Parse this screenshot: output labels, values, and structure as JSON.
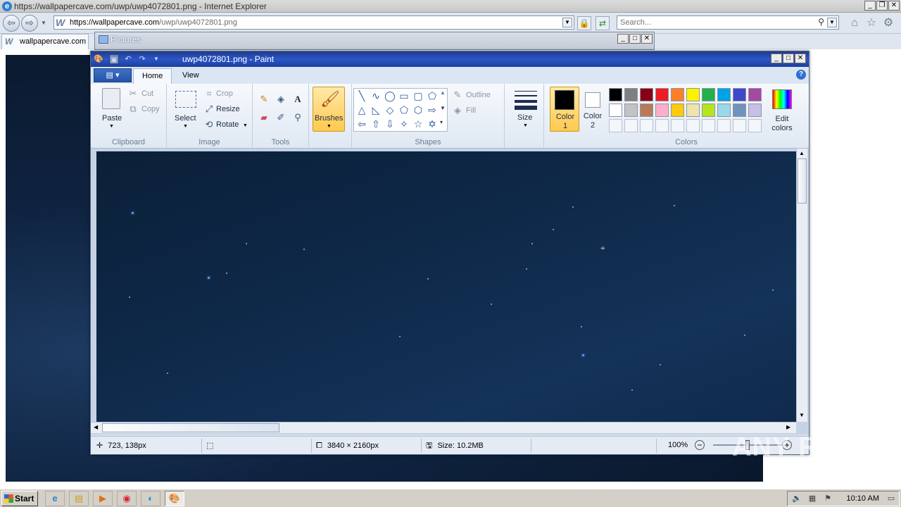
{
  "browser": {
    "title": "https://wallpapercave.com/uwp/uwp4072801.png - Internet Explorer",
    "address": {
      "host": "https://wallpapercave.com",
      "path": "/uwp/uwp4072801.png"
    },
    "search_placeholder": "Search...",
    "tab_label": "wallpapercave.com"
  },
  "pictures_window": {
    "title": "Pictures"
  },
  "paint": {
    "title": "uwp4072801.png - Paint",
    "tabs": [
      "Home",
      "View"
    ],
    "groups": {
      "clipboard": {
        "label": "Clipboard",
        "paste": "Paste",
        "cut": "Cut",
        "copy": "Copy"
      },
      "image": {
        "label": "Image",
        "select": "Select",
        "crop": "Crop",
        "resize": "Resize",
        "rotate": "Rotate"
      },
      "tools": {
        "label": "Tools"
      },
      "brushes": {
        "label": "Brushes"
      },
      "shapes": {
        "label": "Shapes",
        "outline": "Outline",
        "fill": "Fill"
      },
      "size": {
        "label": "Size"
      },
      "colors": {
        "label": "Colors",
        "color1": "Color\n1",
        "color2": "Color\n2",
        "edit": "Edit\ncolors",
        "color1_value": "#000000",
        "color2_value": "#ffffff",
        "palette_row1": [
          "#000000",
          "#7f7f7f",
          "#880015",
          "#ed1c24",
          "#ff7f27",
          "#fff200",
          "#22b14c",
          "#00a2e8",
          "#3f48cc",
          "#a349a4"
        ],
        "palette_row2": [
          "#ffffff",
          "#c3c3c3",
          "#b97a57",
          "#ffaec9",
          "#ffc90e",
          "#efe4b0",
          "#b5e61d",
          "#99d9ea",
          "#7092be",
          "#c8bfe7"
        ]
      }
    },
    "status": {
      "cursor": "723, 138px",
      "dimensions": "3840 × 2160px",
      "size": "Size: 10.2MB",
      "zoom": "100%"
    }
  },
  "taskbar": {
    "start": "Start",
    "clock": "10:10 AM"
  },
  "watermark": "ANY RUN"
}
